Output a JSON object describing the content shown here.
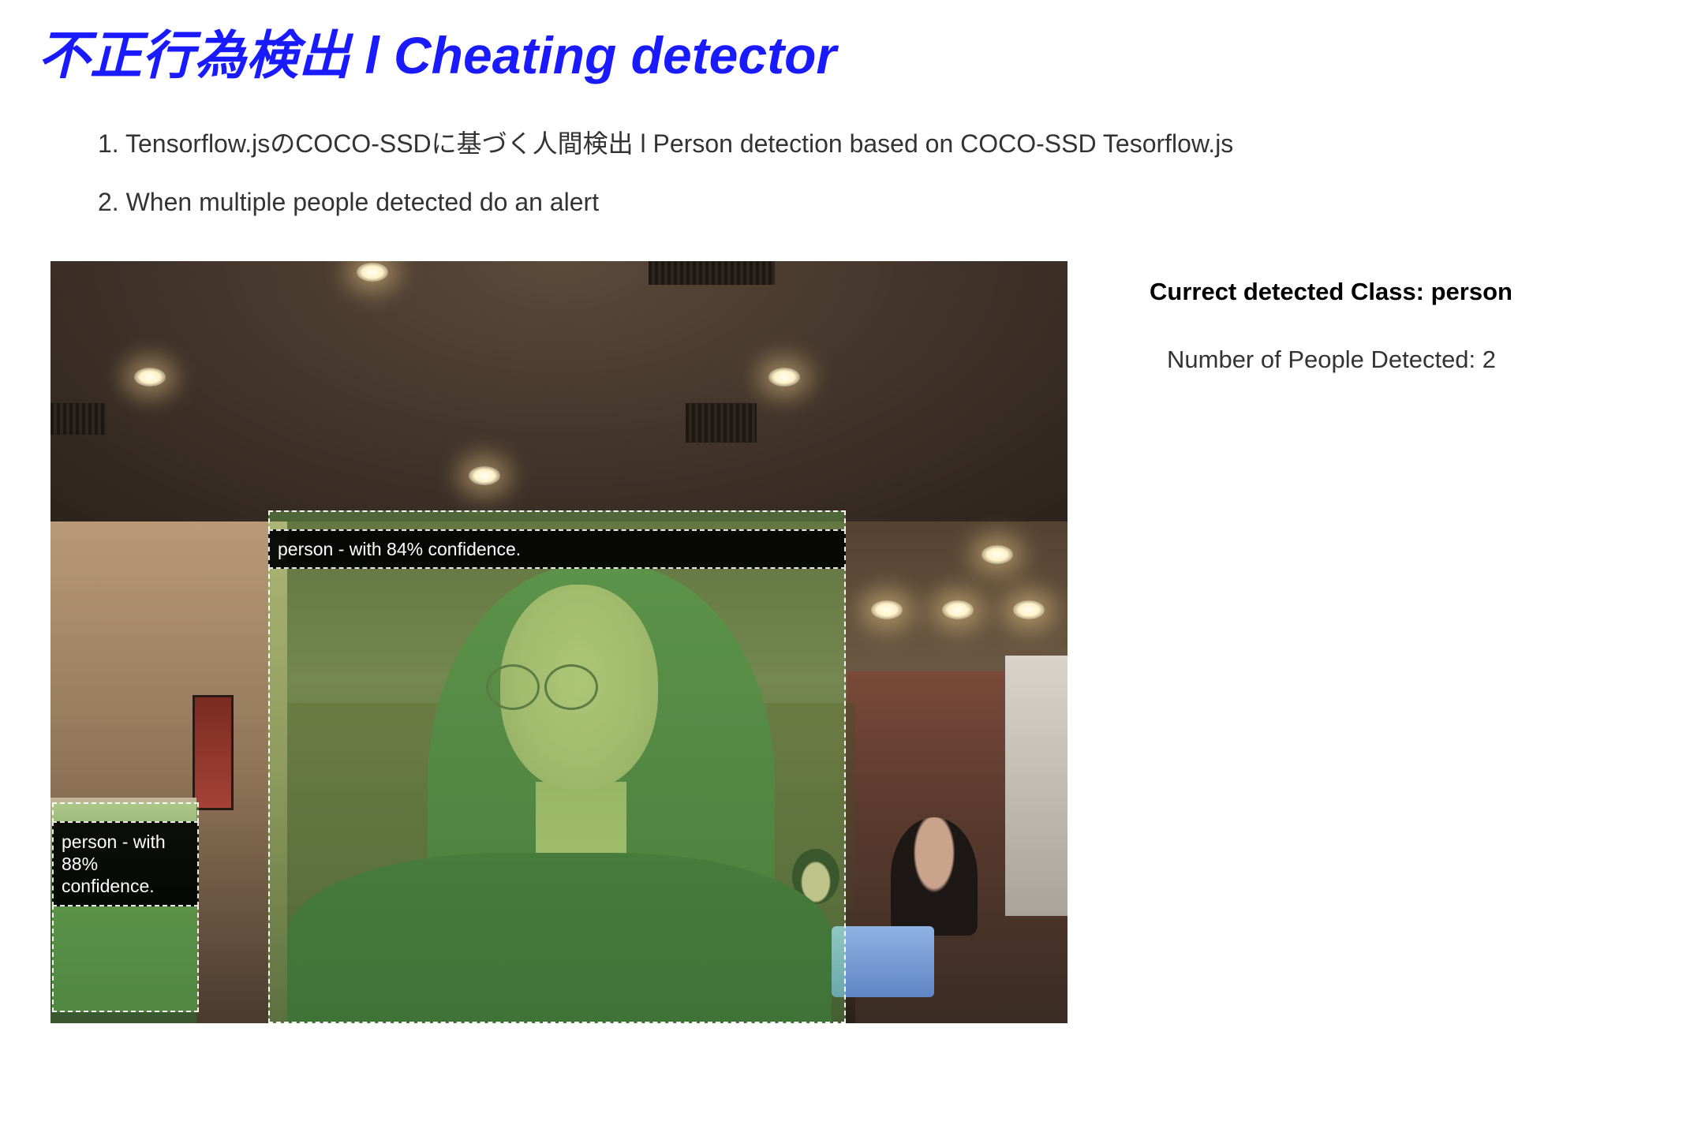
{
  "page": {
    "title": "不正行為検出 l Cheating detector",
    "steps": [
      "1. Tensorflow.jsのCOCO-SSDに基づく人間検出 l Person detection based on COCO-SSD Tesorflow.js",
      "2. When multiple people detected do an alert"
    ]
  },
  "detections": [
    {
      "label": "person - with 84% confidence.",
      "class": "person",
      "confidence_percent": 84
    },
    {
      "label": "person - with 88% confidence.",
      "class": "person",
      "confidence_percent": 88
    }
  ],
  "status": {
    "class_label": "Currect detected Class: person",
    "count_label": "Number of People Detected: 2"
  },
  "colors": {
    "title": "#1a1aff",
    "detection_tint": "#8cff6e",
    "label_bg": "#000000",
    "label_text": "#ffffff"
  }
}
